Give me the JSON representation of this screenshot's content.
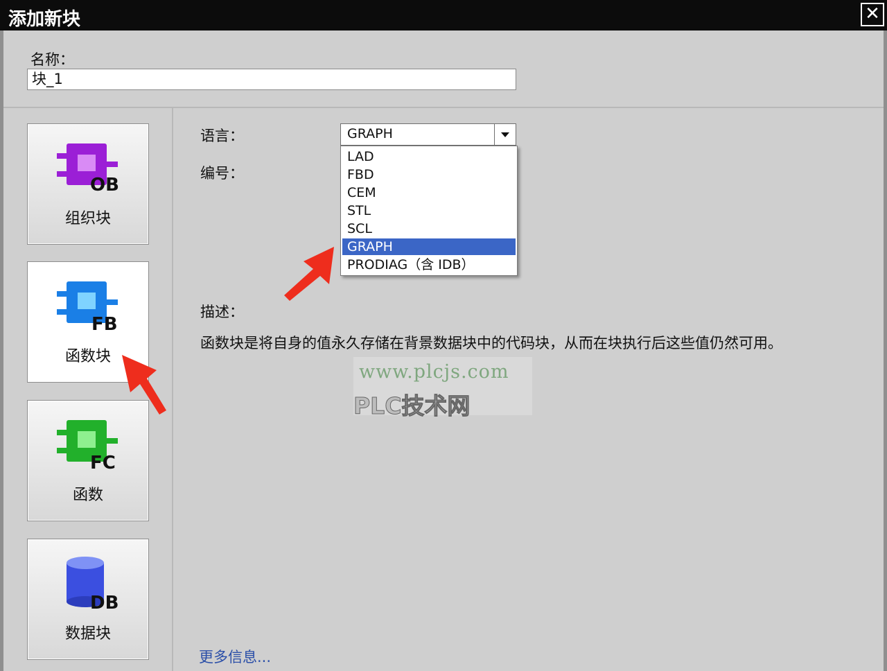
{
  "window": {
    "title": "添加新块",
    "close_glyph": "✕"
  },
  "name_field": {
    "label": "名称：",
    "value": "块_1"
  },
  "block_types": [
    {
      "badge": "OB",
      "label": "组织块",
      "color": "#9b1fd6"
    },
    {
      "badge": "FB",
      "label": "函数块",
      "color": "#1a7fe6",
      "selected": true
    },
    {
      "badge": "FC",
      "label": "函数",
      "color": "#22b02b"
    },
    {
      "badge": "DB",
      "label": "数据块",
      "color": "#3b4fe0"
    }
  ],
  "language": {
    "label": "语言：",
    "selected": "GRAPH",
    "options": [
      "LAD",
      "FBD",
      "CEM",
      "STL",
      "SCL",
      "GRAPH",
      "PRODIAG（含 IDB）"
    ],
    "selected_index": 5
  },
  "number": {
    "label": "编号："
  },
  "description": {
    "label": "描述：",
    "text": "函数块是将自身的值永久存储在背景数据块中的代码块，从而在块执行后这些值仍然可用。"
  },
  "watermark": {
    "url": "www.plcjs.com",
    "brand": "PLC技术网"
  },
  "more_info": {
    "label": "更多信息..."
  },
  "colors": {
    "highlight": "#3b66c6",
    "link": "#2b4fa8",
    "annotation_arrow": "#ee2d1d"
  }
}
